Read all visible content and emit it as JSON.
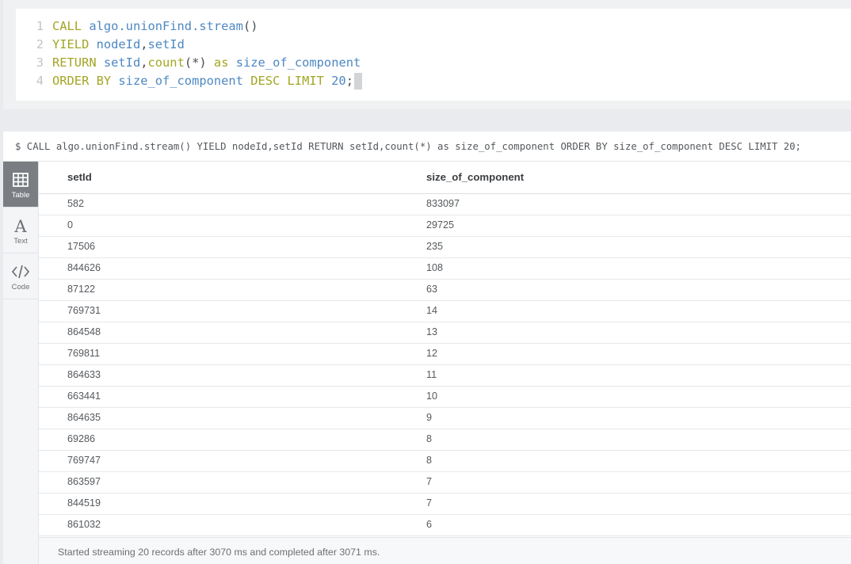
{
  "editor": {
    "lines": [
      {
        "num": "1",
        "tokens": [
          {
            "t": "CALL ",
            "c": "kw"
          },
          {
            "t": "algo.unionFind.stream",
            "c": "id"
          },
          {
            "t": "()",
            "c": "pl"
          }
        ]
      },
      {
        "num": "2",
        "tokens": [
          {
            "t": "YIELD ",
            "c": "kw"
          },
          {
            "t": "nodeId",
            "c": "id"
          },
          {
            "t": ",",
            "c": "pl"
          },
          {
            "t": "setId",
            "c": "id"
          }
        ]
      },
      {
        "num": "3",
        "tokens": [
          {
            "t": "RETURN ",
            "c": "kw"
          },
          {
            "t": "setId",
            "c": "id"
          },
          {
            "t": ",",
            "c": "pl"
          },
          {
            "t": "count",
            "c": "kw"
          },
          {
            "t": "(*) ",
            "c": "pl"
          },
          {
            "t": "as ",
            "c": "kw"
          },
          {
            "t": "size_of_component",
            "c": "id"
          }
        ]
      },
      {
        "num": "4",
        "tokens": [
          {
            "t": "ORDER BY ",
            "c": "kw"
          },
          {
            "t": "size_of_component ",
            "c": "id"
          },
          {
            "t": "DESC LIMIT ",
            "c": "kw"
          },
          {
            "t": "20",
            "c": "id"
          },
          {
            "t": ";",
            "c": "pl"
          }
        ]
      }
    ]
  },
  "frame": {
    "query": "$ CALL algo.unionFind.stream() YIELD nodeId,setId RETURN setId,count(*) as size_of_component ORDER BY size_of_component DESC LIMIT 20;"
  },
  "sidebar": {
    "tabs": [
      {
        "label": "Table",
        "icon": "table-icon",
        "active": true
      },
      {
        "label": "Text",
        "icon": "text-icon",
        "active": false
      },
      {
        "label": "Code",
        "icon": "code-icon",
        "active": false
      }
    ]
  },
  "table": {
    "columns": [
      "setId",
      "size_of_component"
    ],
    "rows": [
      [
        "582",
        "833097"
      ],
      [
        "0",
        "29725"
      ],
      [
        "17506",
        "235"
      ],
      [
        "844626",
        "108"
      ],
      [
        "87122",
        "63"
      ],
      [
        "769731",
        "14"
      ],
      [
        "864548",
        "13"
      ],
      [
        "769811",
        "12"
      ],
      [
        "864633",
        "11"
      ],
      [
        "663441",
        "10"
      ],
      [
        "864635",
        "9"
      ],
      [
        "69286",
        "8"
      ],
      [
        "769747",
        "8"
      ],
      [
        "863597",
        "7"
      ],
      [
        "844519",
        "7"
      ],
      [
        "861032",
        "6"
      ]
    ]
  },
  "status": {
    "text": "Started streaming 20 records after 3070 ms and completed after 3071 ms."
  },
  "colors": {
    "keyword": "#a3a524",
    "identifier": "#4d88c2",
    "active_tab": "#7a7e83"
  }
}
